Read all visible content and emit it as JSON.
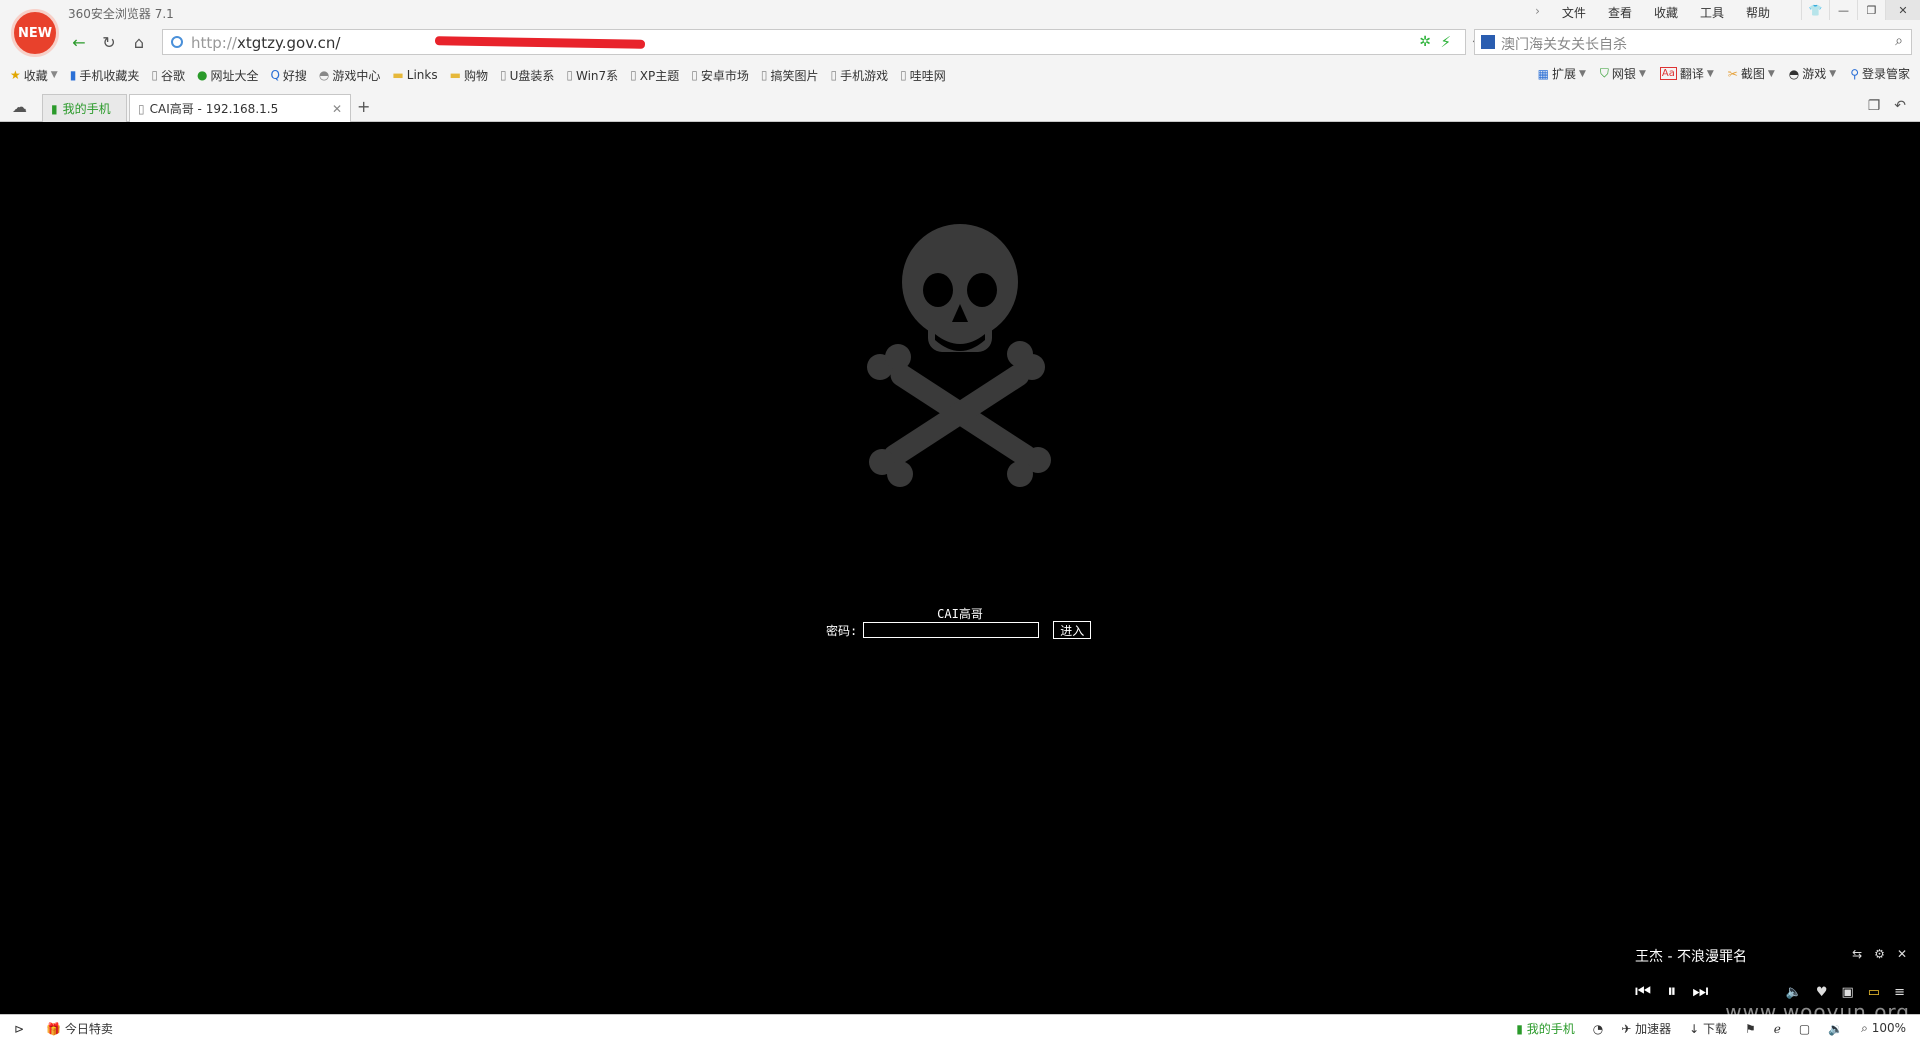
{
  "window": {
    "app_title": "360安全浏览器 7.1",
    "logo_badge": "NEW",
    "menus": [
      "文件",
      "查看",
      "收藏",
      "工具",
      "帮助"
    ]
  },
  "address": {
    "scheme": "http://",
    "host": "xtgtzy.gov.cn/",
    "search_placeholder": "澳门海关女关长自杀"
  },
  "bookmarks": [
    {
      "label": "收藏",
      "icon": "star-icon"
    },
    {
      "label": "手机收藏夹",
      "icon": "phone-icon"
    },
    {
      "label": "谷歌",
      "icon": "page-icon"
    },
    {
      "label": "网址大全",
      "icon": "globe-icon"
    },
    {
      "label": "好搜",
      "icon": "search-icon"
    },
    {
      "label": "游戏中心",
      "icon": "gamepad-icon"
    },
    {
      "label": "Links",
      "icon": "folder-icon"
    },
    {
      "label": "购物",
      "icon": "folder-icon"
    },
    {
      "label": "U盘装系",
      "icon": "page-icon"
    },
    {
      "label": "Win7系",
      "icon": "page-icon"
    },
    {
      "label": "XP主题",
      "icon": "page-icon"
    },
    {
      "label": "安卓市场",
      "icon": "page-icon"
    },
    {
      "label": "搞笑图片",
      "icon": "page-icon"
    },
    {
      "label": "手机游戏",
      "icon": "page-icon"
    },
    {
      "label": "哇哇网",
      "icon": "page-icon"
    }
  ],
  "toolbar_right": [
    "扩展",
    "网银",
    "翻译",
    "截图",
    "游戏",
    "登录管家"
  ],
  "tabs": {
    "phone_tab": "我的手机",
    "active_tab": "CAI高哥 - 192.168.1.5"
  },
  "page": {
    "login_title": "CAI高哥",
    "password_label": "密码:",
    "enter_button": "进入"
  },
  "music": {
    "song": "王杰 - 不浪漫罪名"
  },
  "status": {
    "today_deals": "今日特卖",
    "my_phone": "我的手机",
    "accelerator": "加速器",
    "download": "下载",
    "zoom": "100%"
  },
  "watermark": "www.wooyun.org",
  "colors": {
    "brand_logo": "#e8412c",
    "redaction": "#e8232b",
    "accent_green": "#2a9a2a",
    "page_background": "#000000"
  }
}
